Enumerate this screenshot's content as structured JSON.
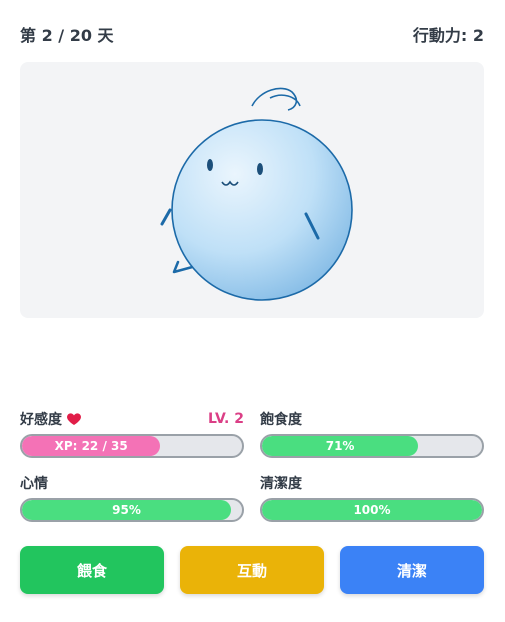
{
  "header": {
    "day": "第 2 / 20 天",
    "ap": "行動力: 2"
  },
  "stats": {
    "affection": {
      "label": "好感度",
      "level": "LV. 2",
      "xp_text": "XP: 22 / 35",
      "fraction": 0.6286,
      "icon": "heart-icon"
    },
    "satiety": {
      "label": "飽食度",
      "value_text": "71%",
      "fraction": 0.71
    },
    "mood": {
      "label": "心情",
      "value_text": "95%",
      "fraction": 0.95
    },
    "cleanliness": {
      "label": "清潔度",
      "value_text": "100%",
      "fraction": 1.0
    }
  },
  "actions": {
    "feed": "餵食",
    "interact": "互動",
    "clean": "清潔"
  },
  "colors": {
    "bar_green": "#4ade80",
    "bar_pink": "#f472b6",
    "feed": "#22c55e",
    "interact": "#eab308",
    "clean": "#3b82f6",
    "level": "#db3f86"
  }
}
